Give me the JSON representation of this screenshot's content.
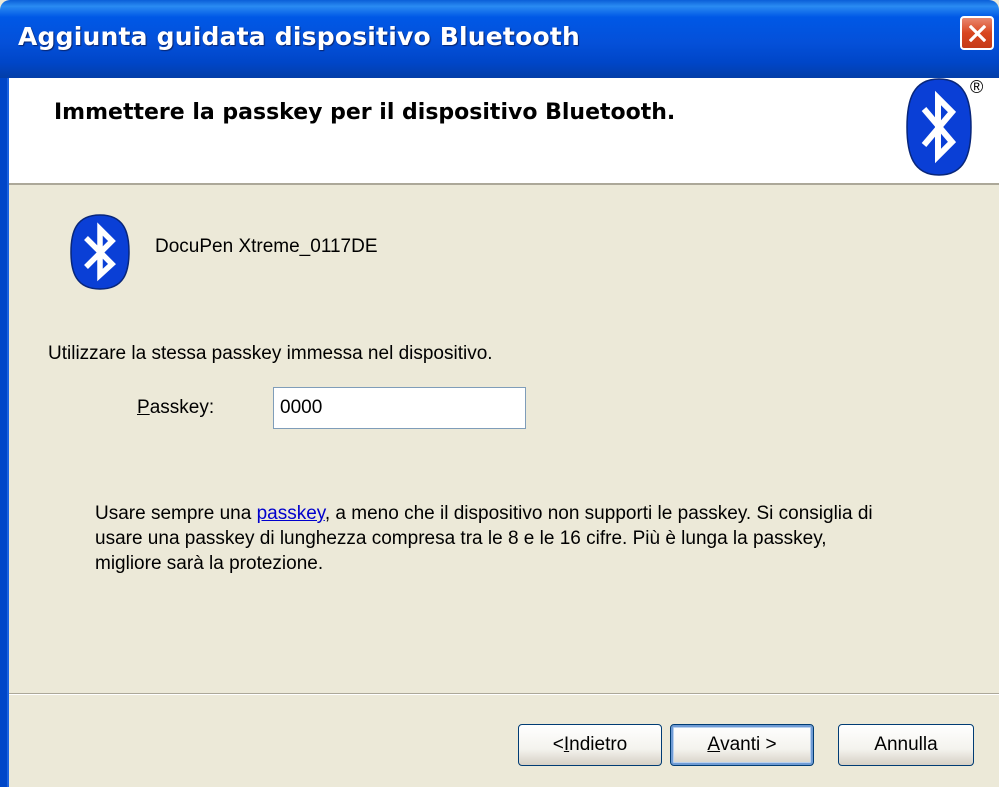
{
  "window": {
    "title": "Aggiunta guidata dispositivo Bluetooth"
  },
  "header": {
    "heading": "Immettere la passkey per il dispositivo Bluetooth.",
    "registered_mark": "®"
  },
  "device": {
    "name": "DocuPen Xtreme_0117DE"
  },
  "form": {
    "instruction": "Utilizzare la stessa passkey immessa nel dispositivo.",
    "passkey_label_accel": "P",
    "passkey_label_rest": "asskey:",
    "passkey_value": "0000"
  },
  "note": {
    "before_link": "Usare sempre una ",
    "link_text": "passkey",
    "after_link": ", a meno che il dispositivo non supporti le passkey. Si consiglia di usare una passkey di lunghezza compresa tra le 8 e le 16 cifre. Più è lunga la passkey, migliore sarà la protezione."
  },
  "buttons": {
    "back_prefix": "< ",
    "back_accel": "I",
    "back_rest": "ndietro",
    "next_accel": "A",
    "next_rest": "vanti >",
    "cancel": "Annulla"
  },
  "colors": {
    "titlebar": "#0058e6",
    "dialog_bg": "#ece9d8",
    "bluetooth_blue": "#0a3fd6",
    "link": "#0000cc",
    "close_button": "#d9461f"
  },
  "icons": {
    "close": "close-icon",
    "bluetooth_header": "bluetooth-logo-icon",
    "device": "bluetooth-device-icon"
  }
}
